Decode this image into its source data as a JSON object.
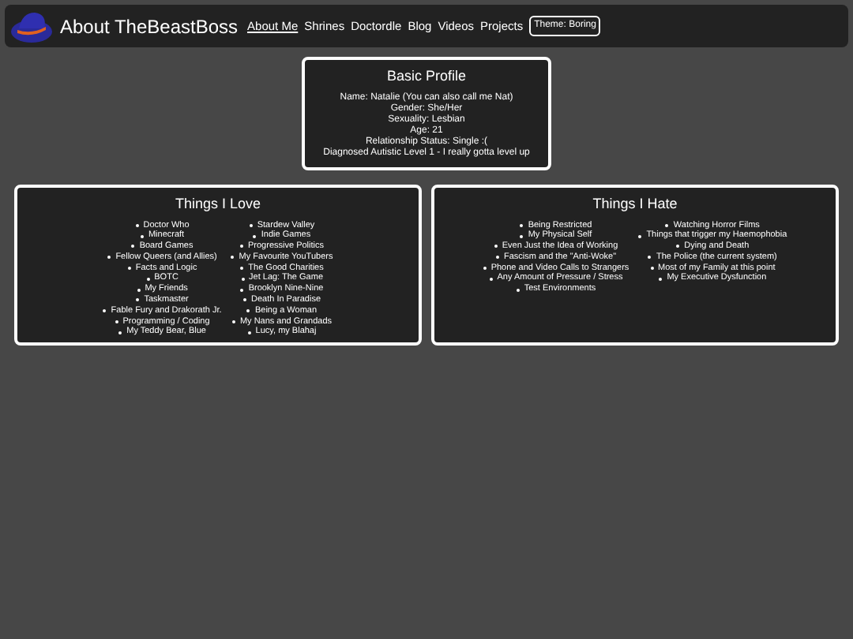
{
  "header": {
    "title": "About TheBeastBoss",
    "nav": [
      {
        "label": "About Me",
        "selected": true
      },
      {
        "label": "Shrines",
        "selected": false
      },
      {
        "label": "Doctordle",
        "selected": false
      },
      {
        "label": "Blog",
        "selected": false
      },
      {
        "label": "Videos",
        "selected": false
      },
      {
        "label": "Projects",
        "selected": false
      }
    ],
    "theme_button": "Theme: Boring"
  },
  "profile": {
    "title": "Basic Profile",
    "lines": [
      "Name: Natalie (You can also call me Nat)",
      "Gender: She/Her",
      "Sexuality: Lesbian",
      "Age: 21",
      "Relationship Status: Single :(",
      "Diagnosed Autistic Level 1 - I really gotta level up"
    ]
  },
  "lists": [
    {
      "title": "Things I Love",
      "columns": [
        [
          "Doctor Who",
          "Minecraft",
          "Board Games",
          "Fellow Queers (and Allies)",
          "Facts and Logic",
          "BOTC",
          "My Friends",
          "Taskmaster",
          "Fable Fury and Drakorath Jr.",
          "Programming / Coding",
          "My Teddy Bear, Blue"
        ],
        [
          "Stardew Valley",
          "Indie Games",
          "Progressive Politics",
          "My Favourite YouTubers",
          "The Good Charities",
          "Jet Lag: The Game",
          "Brooklyn Nine-Nine",
          "Death In Paradise",
          "Being a Woman",
          "My Nans and Grandads",
          "Lucy, my Blahaj"
        ]
      ]
    },
    {
      "title": "Things I Hate",
      "columns": [
        [
          "Being Restricted",
          "My Physical Self",
          "Even Just the Idea of Working",
          "Fascism and the \"Anti-Woke\"",
          "Phone and Video Calls to Strangers",
          "Any Amount of Pressure / Stress",
          "Test Environments"
        ],
        [
          "Watching Horror Films",
          "Things that trigger my Haemophobia",
          "Dying and Death",
          "The Police (the current system)",
          "Most of my Family at this point",
          "My Executive Dysfunction"
        ]
      ]
    }
  ]
}
